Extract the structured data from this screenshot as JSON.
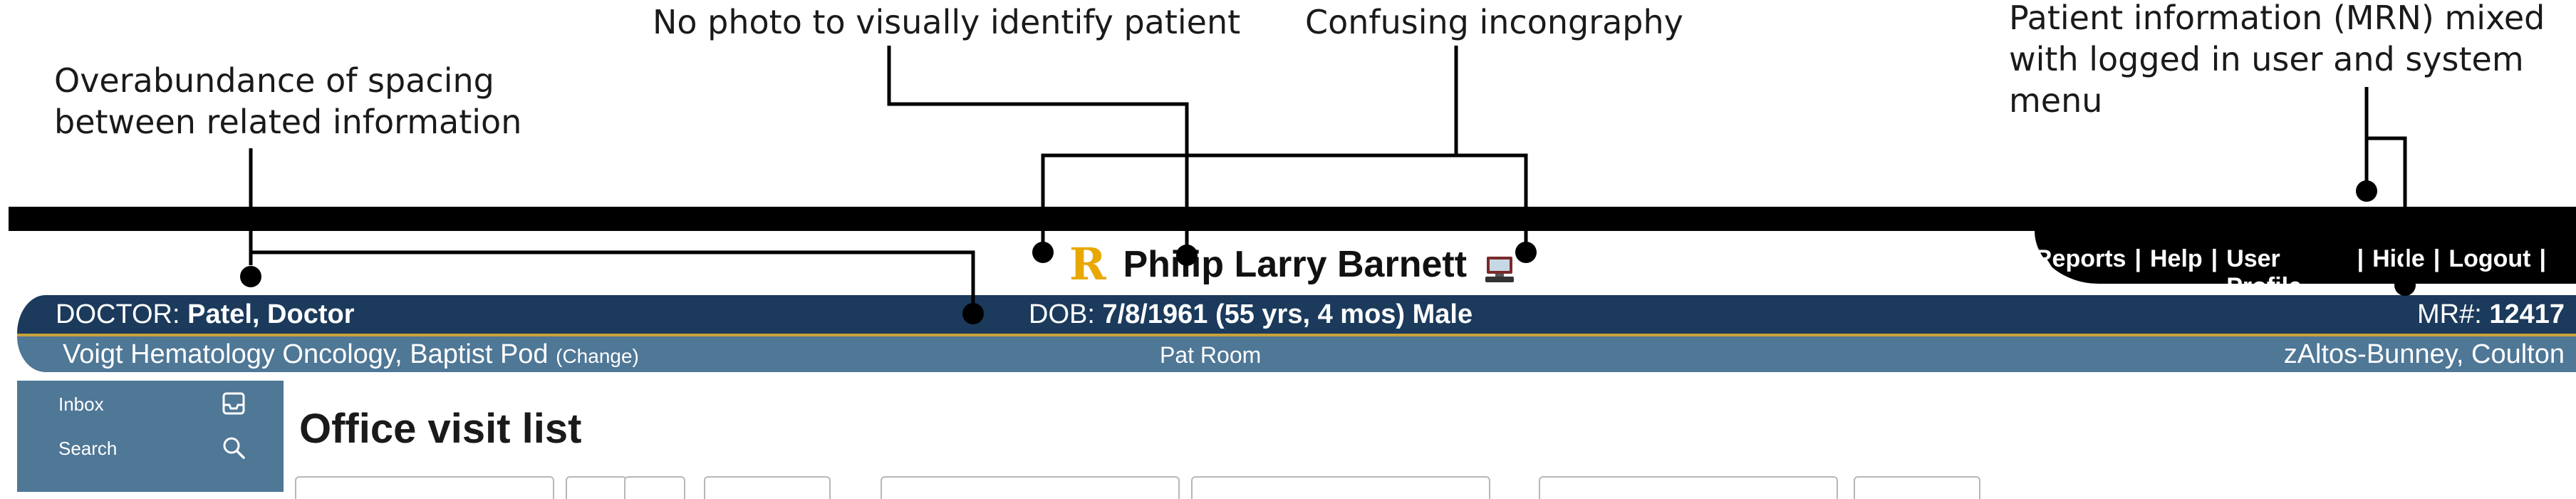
{
  "annotations": {
    "spacing": "Overabundance of spacing\nbetween related information",
    "no_photo": "No photo to visually identify patient",
    "iconography": "Confusing incongraphy",
    "mrn_mixed": "Patient information (MRN) mixed\nwith logged in user and system menu"
  },
  "system_menu": {
    "items": [
      "Reports",
      "Help",
      "User Profile",
      "Hide",
      "Logout"
    ],
    "separator": "|"
  },
  "patient": {
    "badge": "R",
    "name": "Philip Larry Barnett"
  },
  "header": {
    "doctor_label": "DOCTOR:",
    "doctor_value": "Patel, Doctor",
    "dob_label": "DOB:",
    "dob_value": "7/8/1961 (55 yrs, 4 mos) Male",
    "mrn_label": "MR#:",
    "mrn_value": "12417",
    "location": "Voigt Hematology Oncology, Baptist Pod",
    "change_label": "(Change)",
    "room": "Pat Room",
    "user": "zAltos-Bunney, Coulton"
  },
  "sidebar": {
    "items": [
      {
        "label": "Inbox",
        "icon": "inbox-icon"
      },
      {
        "label": "Search",
        "icon": "search-icon"
      }
    ]
  },
  "main": {
    "title": "Office visit list"
  },
  "colors": {
    "header_dark": "#1b3a5c",
    "header_light": "#4f7796",
    "accent_gold": "#c9a23a",
    "badge_yellow": "#e8a800"
  }
}
